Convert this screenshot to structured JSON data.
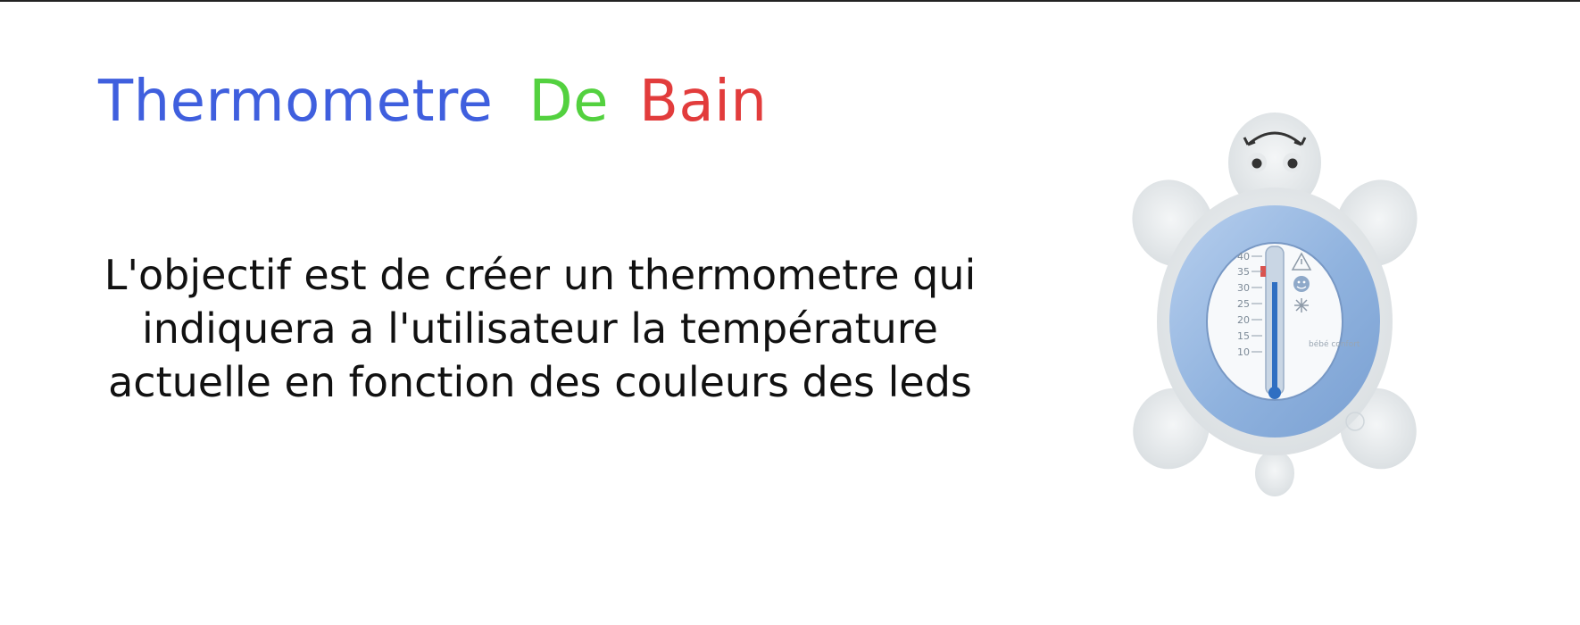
{
  "title": {
    "word1": "Thermometre",
    "word2": "De",
    "word3": "Bain"
  },
  "description": {
    "line1": "L'objectif est de créer un thermometre qui",
    "line2": "indiquera a l'utilisateur la température",
    "line3": "actuelle en fonction des couleurs des leds"
  },
  "image": {
    "icon": "turtle-bath-thermometer",
    "scale_labels": [
      "40",
      "35",
      "30",
      "25",
      "20",
      "15",
      "10"
    ],
    "brand": "bébé confort"
  },
  "colors": {
    "title_word1": "#3f5fde",
    "title_word2": "#53d13f",
    "title_word3": "#e23c3c",
    "ring": "#94b6e0"
  }
}
